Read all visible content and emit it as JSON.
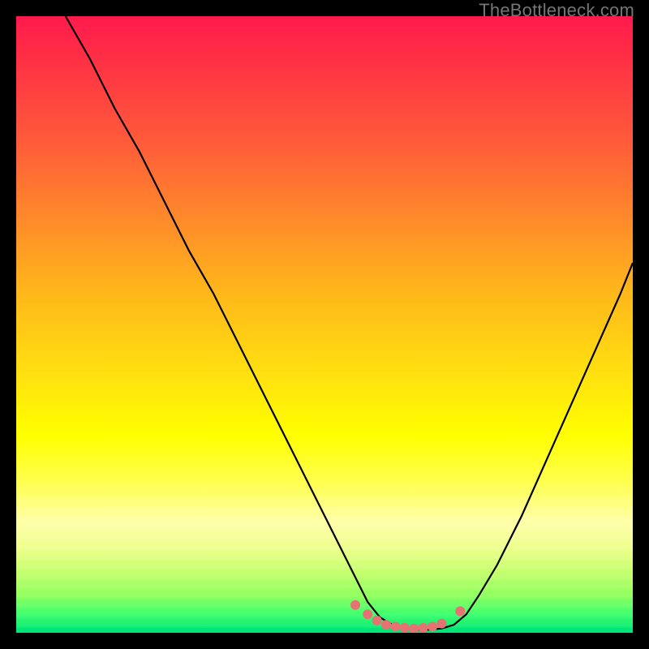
{
  "watermark": "TheBottleneck.com",
  "chart_data": {
    "type": "line",
    "title": "",
    "xlabel": "",
    "ylabel": "",
    "xlim": [
      0,
      100
    ],
    "ylim": [
      0,
      100
    ],
    "grid": false,
    "legend": false,
    "note": "No axis labels or tick marks are shown; x and y are normalized 0–100. The curve is a V-shaped profile with a near-zero flat bottom centered around x≈58–70, rising steeply on both sides.",
    "series": [
      {
        "name": "curve",
        "color": "#000000",
        "x": [
          8,
          12,
          16,
          20,
          24,
          28,
          32,
          36,
          40,
          44,
          48,
          52,
          55,
          57,
          59,
          61,
          63,
          65,
          67,
          69,
          71,
          73,
          75,
          78,
          82,
          86,
          90,
          94,
          98,
          100
        ],
        "y": [
          100,
          93,
          85,
          78,
          70,
          62,
          55,
          47,
          39,
          31,
          23,
          15,
          9,
          5,
          2.5,
          1.3,
          0.7,
          0.5,
          0.5,
          0.7,
          1.3,
          3,
          6,
          11,
          19,
          28,
          37,
          46,
          55,
          60
        ]
      }
    ],
    "markers": {
      "name": "bottom-dots",
      "color": "#e57373",
      "radius": 6,
      "points": [
        {
          "x": 55,
          "y": 4.5
        },
        {
          "x": 57,
          "y": 3.0
        },
        {
          "x": 58.5,
          "y": 2.0
        },
        {
          "x": 60,
          "y": 1.3
        },
        {
          "x": 61.5,
          "y": 1.0
        },
        {
          "x": 63,
          "y": 0.8
        },
        {
          "x": 64.5,
          "y": 0.7
        },
        {
          "x": 66,
          "y": 0.8
        },
        {
          "x": 67.5,
          "y": 1.0
        },
        {
          "x": 69,
          "y": 1.5
        },
        {
          "x": 72,
          "y": 3.5
        }
      ]
    }
  }
}
